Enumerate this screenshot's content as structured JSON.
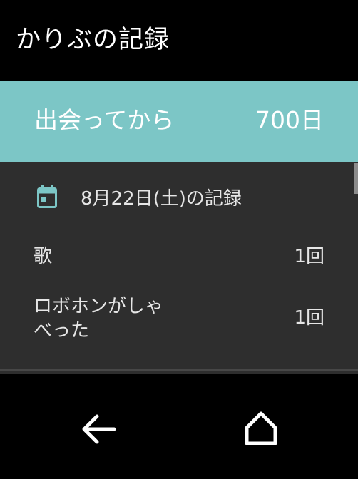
{
  "app": {
    "title": "かりぶの記録"
  },
  "banner": {
    "label": "出会ってから",
    "value": "700日",
    "color": "#7cc6c6"
  },
  "record": {
    "date_label": "8月22日(土)の記録",
    "calendar_icon": "calendar-icon",
    "items": [
      {
        "label_lines": [
          "歌"
        ],
        "count": "1回"
      },
      {
        "label_lines": [
          "ロボホンがしゃ",
          "べった"
        ],
        "count": "1回"
      }
    ]
  },
  "navigation": {
    "back_icon": "arrow-back-icon",
    "home_icon": "home-icon"
  },
  "colors": {
    "background": "#000000",
    "panel": "#2e2e2e",
    "accent": "#7cc6c6",
    "text": "#ffffff"
  }
}
